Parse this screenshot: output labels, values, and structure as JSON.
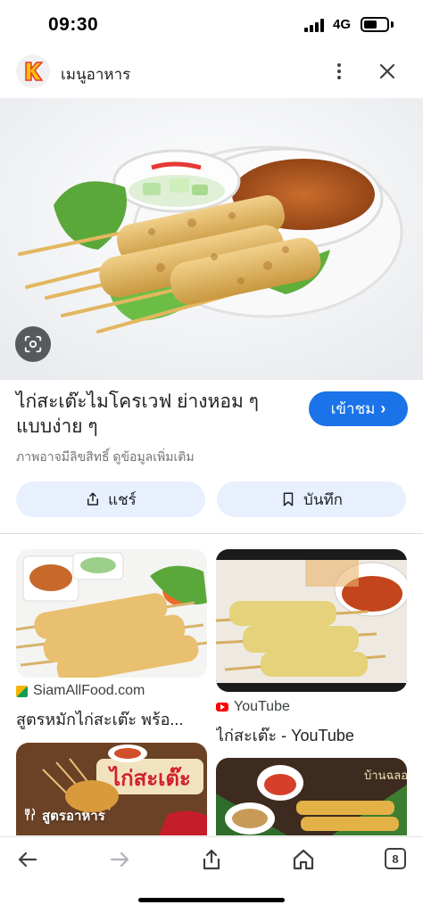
{
  "status_bar": {
    "time": "09:30",
    "network": "4G",
    "battery_level": 0.55
  },
  "header": {
    "title": "เมนูอาหาร",
    "logo_icon": "k-logo-icon",
    "menu_icon": "more-vert-icon",
    "close_icon": "close-icon"
  },
  "hero": {
    "description_icon": "lens-search-icon"
  },
  "result": {
    "title": "ไก่สะเต๊ะไมโครเวฟ ย่างหอม ๆ แบบง่าย ๆ",
    "visit_label": "เข้าชม",
    "visit_chevron": "›",
    "copyright_note": "ภาพอาจมีลิขสิทธิ์ ดูข้อมูลเพิ่มเติม"
  },
  "actions": {
    "share_label": "แชร์",
    "save_label": "บันทึก"
  },
  "related": [
    {
      "source": "SiamAllFood.com",
      "caption": "สูตรหมักไก่สะเต๊ะ พร้อ...",
      "source_icon": "site-favicon-icon"
    },
    {
      "source": "YouTube",
      "caption": "ไก่สะเต๊ะ - YouTube",
      "source_icon": "youtube-icon"
    },
    {
      "chip": "สูตรอาหาร",
      "chip_icon": "fork-knife-icon",
      "banner_text": "ไก่สะเต๊ะ"
    },
    {
      "overlay_text": "บ้านฉลอง"
    }
  ],
  "bottom_nav": {
    "tab_count": "8"
  },
  "colors": {
    "accent": "#1a73e8",
    "pill_bg": "#e8f0fe",
    "youtube": "#ff0000"
  }
}
